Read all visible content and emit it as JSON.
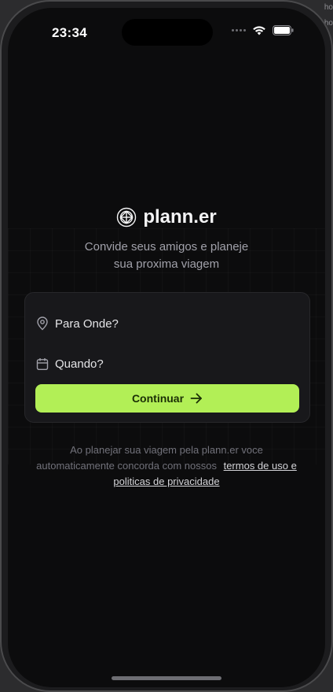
{
  "status_bar": {
    "time": "23:34"
  },
  "background_text": [
    "ho",
    "ho"
  ],
  "brand": {
    "name": "plann.er",
    "icon": "globe-icon"
  },
  "tagline": {
    "line1": "Convide seus amigos e planeje",
    "line2": "sua proxima viagem"
  },
  "form": {
    "destination": {
      "icon": "map-pin-icon",
      "placeholder": "Para Onde?"
    },
    "date": {
      "icon": "calendar-icon",
      "placeholder": "Quando?"
    },
    "continue_label": "Continuar",
    "continue_icon": "arrow-right-icon"
  },
  "footer": {
    "text_line1": "Ao planejar sua viagem pela plann.er voce",
    "text_line2": "automaticamente concorda com nossos",
    "terms_link": "termos de uso e",
    "privacy_link": "politicas de privacidade"
  },
  "colors": {
    "accent": "#b2ef56",
    "screen_bg": "#0c0c0d",
    "card_bg": "#18181b"
  }
}
